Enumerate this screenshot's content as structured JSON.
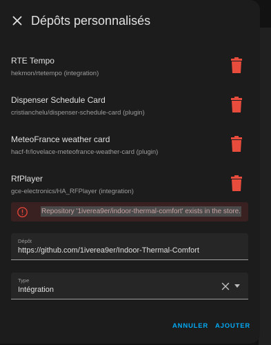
{
  "dialog": {
    "title": "Dépôts personnalisés",
    "close_icon": "close-icon"
  },
  "repositories": [
    {
      "name": "RTE Tempo",
      "subtitle": "hekmon/rtetempo (integration)",
      "delete_icon": "trash-icon"
    },
    {
      "name": "Dispenser Schedule Card",
      "subtitle": "cristianchelu/dispenser-schedule-card (plugin)",
      "delete_icon": "trash-icon"
    },
    {
      "name": "MeteoFrance weather card",
      "subtitle": "hacf-fr/lovelace-meteofrance-weather-card (plugin)",
      "delete_icon": "trash-icon"
    },
    {
      "name": "RfPlayer",
      "subtitle": "gce-electronics/HA_RFPlayer (integration)",
      "delete_icon": "trash-icon"
    }
  ],
  "alert": {
    "icon": "error-circle-icon",
    "message": "Repository '1iverea9er/indoor-thermal-comfort' exists in the store."
  },
  "form": {
    "repo_field": {
      "label": "Dépôt",
      "value": "https://github.com/1iverea9er/Indoor-Thermal-Comfort"
    },
    "type_field": {
      "label": "Type",
      "value": "Intégration"
    }
  },
  "actions": {
    "cancel_label": "ANNULER",
    "add_label": "AJOUTER"
  },
  "colors": {
    "accent": "#03a9f4",
    "delete": "#e74c3c",
    "error": "#db4437"
  }
}
